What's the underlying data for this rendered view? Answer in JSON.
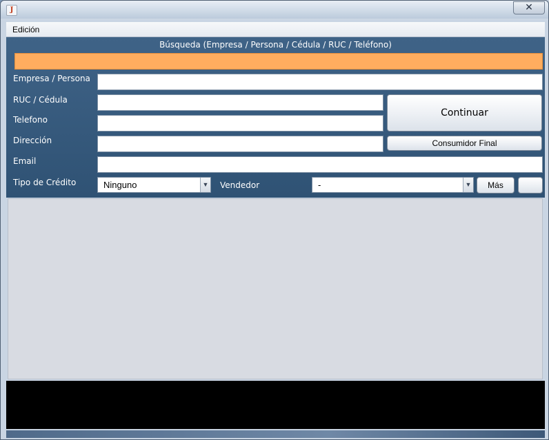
{
  "window": {
    "title": "",
    "close_glyph": "✕"
  },
  "menu": {
    "items": [
      "Edición"
    ]
  },
  "search": {
    "title": "Búsqueda (Empresa / Persona / Cédula / RUC / Teléfono)",
    "value": ""
  },
  "form": {
    "labels": {
      "empresa": "Empresa / Persona",
      "ruc": "RUC / Cédula",
      "telefono": "Telefono",
      "direccion": "Dirección",
      "email": "Email",
      "tipo_credito": "Tipo de Crédito",
      "vendedor": "Vendedor"
    },
    "values": {
      "empresa": "",
      "ruc": "",
      "telefono": "",
      "direccion": "",
      "email": ""
    },
    "tipo_credito_selected": "Ninguno",
    "vendedor_selected": "-"
  },
  "buttons": {
    "continuar": "Continuar",
    "consumidor_final": "Consumidor Final",
    "mas": "Más",
    "extra": ""
  },
  "icons": {
    "app": "java-icon",
    "dropdown": "chevron-down-icon"
  },
  "colors": {
    "panel": "#3f6387",
    "search_bar": "#ffad5f",
    "content": "#d8dbe2",
    "status": "#000000"
  }
}
